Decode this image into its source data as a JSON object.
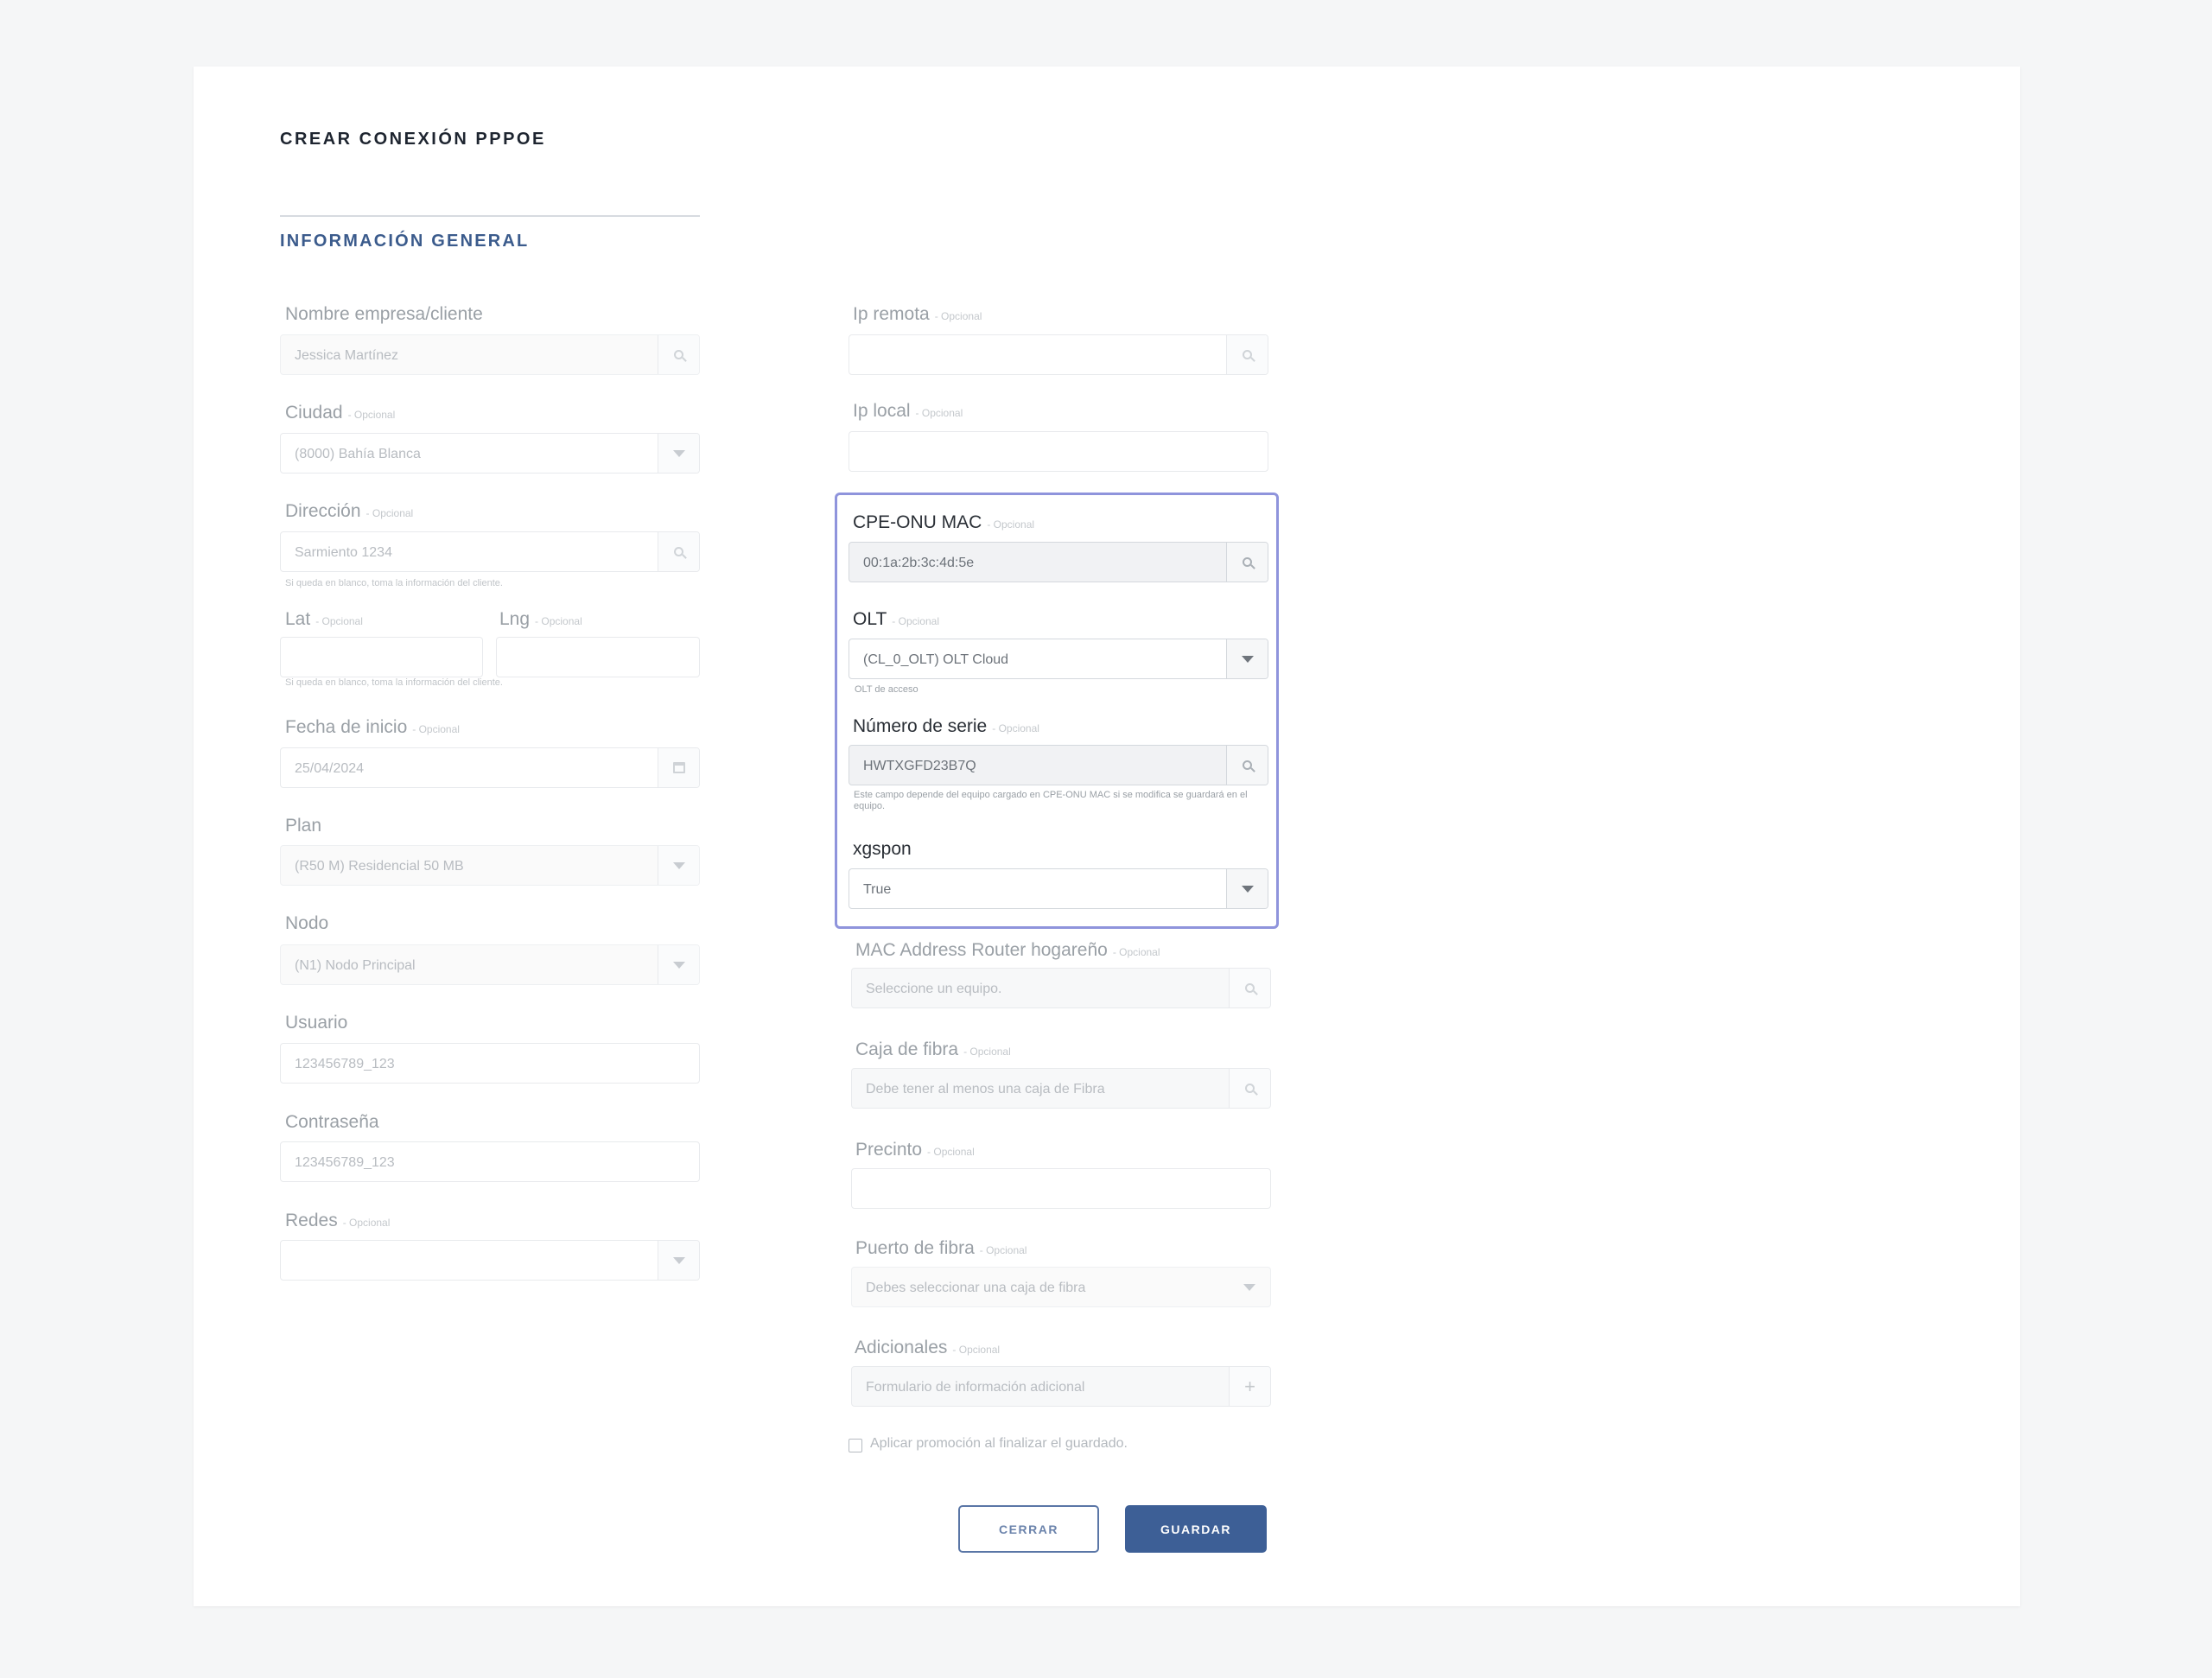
{
  "title": "CREAR CONEXIÓN PPPOE",
  "section_title": "INFORMACIÓN GENERAL",
  "optional_tag": "- Opcional",
  "left": {
    "nombre": {
      "label": "Nombre empresa/cliente",
      "value": "Jessica Martínez"
    },
    "ciudad": {
      "label": "Ciudad",
      "value": "(8000) Bahía Blanca"
    },
    "direccion": {
      "label": "Dirección",
      "value": "Sarmiento 1234",
      "hint": "Si queda en blanco, toma la información del cliente."
    },
    "lat": {
      "label": "Lat",
      "value": ""
    },
    "lng": {
      "label": "Lng",
      "value": ""
    },
    "latlng_hint": "Si queda en blanco, toma la información del cliente.",
    "fecha": {
      "label": "Fecha de inicio",
      "value": "25/04/2024"
    },
    "plan": {
      "label": "Plan",
      "value": "(R50 M) Residencial 50 MB"
    },
    "nodo": {
      "label": "Nodo",
      "value": "(N1) Nodo Principal"
    },
    "usuario": {
      "label": "Usuario",
      "value": "123456789_123"
    },
    "contrasena": {
      "label": "Contraseña",
      "value": "123456789_123"
    },
    "redes": {
      "label": "Redes",
      "value": ""
    }
  },
  "right": {
    "ip_remota": {
      "label": "Ip remota",
      "value": ""
    },
    "ip_local": {
      "label": "Ip local",
      "value": ""
    },
    "cpe_mac": {
      "label": "CPE-ONU MAC",
      "value": "00:1a:2b:3c:4d:5e"
    },
    "olt": {
      "label": "OLT",
      "value": "(CL_0_OLT) OLT Cloud",
      "hint": "OLT de acceso"
    },
    "serie": {
      "label": "Número de serie",
      "value": "HWTXGFD23B7Q",
      "hint": "Este campo depende del equipo cargado en CPE-ONU MAC si se modifica se guardará en el equipo."
    },
    "xgspon": {
      "label": "xgspon",
      "value": "True"
    },
    "mac_router": {
      "label": "MAC Address Router hogareño",
      "placeholder": "Seleccione un equipo."
    },
    "caja": {
      "label": "Caja de fibra",
      "placeholder": "Debe tener al menos una caja de Fibra"
    },
    "precinto": {
      "label": "Precinto",
      "value": ""
    },
    "puerto": {
      "label": "Puerto de fibra",
      "placeholder": "Debes seleccionar una caja de fibra"
    },
    "adicionales": {
      "label": "Adicionales",
      "placeholder": "Formulario de información adicional"
    }
  },
  "promo_label": "Aplicar promoción al finalizar el guardado.",
  "buttons": {
    "close": "CERRAR",
    "save": "GUARDAR"
  },
  "icons": {
    "search": "search-icon",
    "dropdown": "chevron-down-icon",
    "calendar": "calendar-icon",
    "plus": "plus-icon"
  },
  "colors": {
    "accent": "#3d5f96",
    "highlight": "#8f94dc"
  }
}
